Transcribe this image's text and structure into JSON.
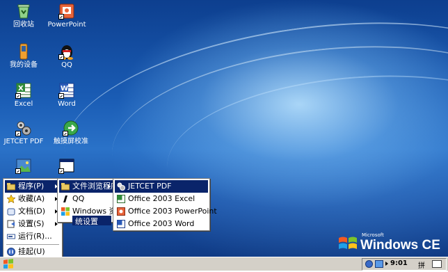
{
  "desktop": {
    "icons": [
      {
        "label": "回收站",
        "icon": "recycle-bin-icon"
      },
      {
        "label": "PowerPoint",
        "icon": "powerpoint-icon"
      },
      {
        "label": "我的设备",
        "icon": "my-device-icon"
      },
      {
        "label": "QQ",
        "icon": "qq-penguin-icon"
      },
      {
        "label": "Excel",
        "icon": "excel-icon"
      },
      {
        "label": "Word",
        "icon": "word-icon"
      },
      {
        "label": "JETCET PDF",
        "icon": "jetcet-pdf-icon"
      },
      {
        "label": "触摸屏校准",
        "icon": "touch-calibrate-icon"
      },
      {
        "label": "",
        "icon": "image-file-icon"
      },
      {
        "label": "",
        "icon": "window-program-icon"
      }
    ],
    "logo": {
      "microsoft": "Microsoft",
      "windows_ce": "Windows CE"
    }
  },
  "start_menu": {
    "items": [
      {
        "label": "程序(P)",
        "icon": "programs-folder-icon",
        "submenu": true
      },
      {
        "label": "收藏(A)",
        "icon": "favorites-star-icon",
        "submenu": true
      },
      {
        "label": "文档(D)",
        "icon": "documents-icon",
        "submenu": true
      },
      {
        "label": "设置(S)",
        "icon": "settings-icon",
        "submenu": true
      },
      {
        "label": "运行(R)...",
        "icon": "run-icon",
        "submenu": false
      },
      {
        "label": "挂起(U)",
        "icon": "suspend-icon",
        "submenu": false
      }
    ]
  },
  "programs_menu": {
    "items": [
      {
        "label": "文件浏览程序",
        "icon": "folder-icon"
      },
      {
        "label": "QQ",
        "icon": "qq-icon"
      },
      {
        "label": "Windows 资源",
        "icon": "windows-flag-icon"
      }
    ],
    "partial_text": "统设置"
  },
  "explorer_submenu": {
    "items": [
      {
        "label": "JETCET PDF",
        "icon": "jetcet-pdf-small-icon"
      },
      {
        "label": "Office 2003 Excel",
        "icon": "excel-small-icon"
      },
      {
        "label": "Office 2003 PowerPoint",
        "icon": "powerpoint-small-icon"
      },
      {
        "label": "Office 2003 Word",
        "icon": "word-small-icon"
      }
    ]
  },
  "taskbar": {
    "clock": "9:01",
    "ime": "拼"
  },
  "colors": {
    "selection": "#0a246a",
    "taskbar": "#d4d0c8",
    "desktop": "#1a5cb4"
  }
}
